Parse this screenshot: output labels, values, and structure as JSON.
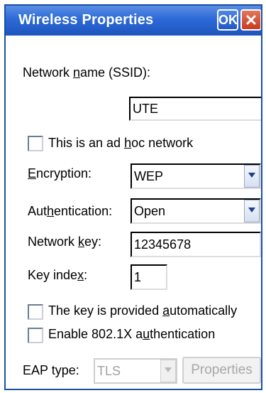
{
  "titlebar": {
    "title": "Wireless Properties",
    "ok_label": "OK",
    "close_icon": "close-icon"
  },
  "labels": {
    "network_name_pre": "Network ",
    "network_name_u": "n",
    "network_name_post": "ame (SSID):",
    "adhoc_pre": "This is an ad ",
    "adhoc_u": "h",
    "adhoc_post": "oc network",
    "encryption_u": "E",
    "encryption_post": "ncryption:",
    "auth_pre": "Aut",
    "auth_u": "h",
    "auth_post": "entication:",
    "netkey_pre": "Network ",
    "netkey_u": "k",
    "netkey_post": "ey:",
    "keyindex_pre": "Key inde",
    "keyindex_u": "x",
    "keyindex_post": ":",
    "auto_pre": "The key is provided ",
    "auto_u": "a",
    "auto_post": "utomatically",
    "eap_enable_pre": "Enable 802.1X a",
    "eap_enable_u": "u",
    "eap_enable_post": "thentication",
    "eap_type": "EAP type:"
  },
  "fields": {
    "ssid_value": "UTE",
    "encryption_value": "WEP",
    "authentication_value": "Open",
    "network_key_value": "12345678",
    "key_index_value": "1",
    "eap_type_value": "TLS"
  },
  "buttons": {
    "properties_label": "Properties"
  },
  "checkboxes": {
    "adhoc": false,
    "auto_key": false,
    "enable_8021x": false
  },
  "colors": {
    "titlebar": "#2c6ad7",
    "close": "#c73c1e",
    "frame": "#1a4fa6"
  }
}
